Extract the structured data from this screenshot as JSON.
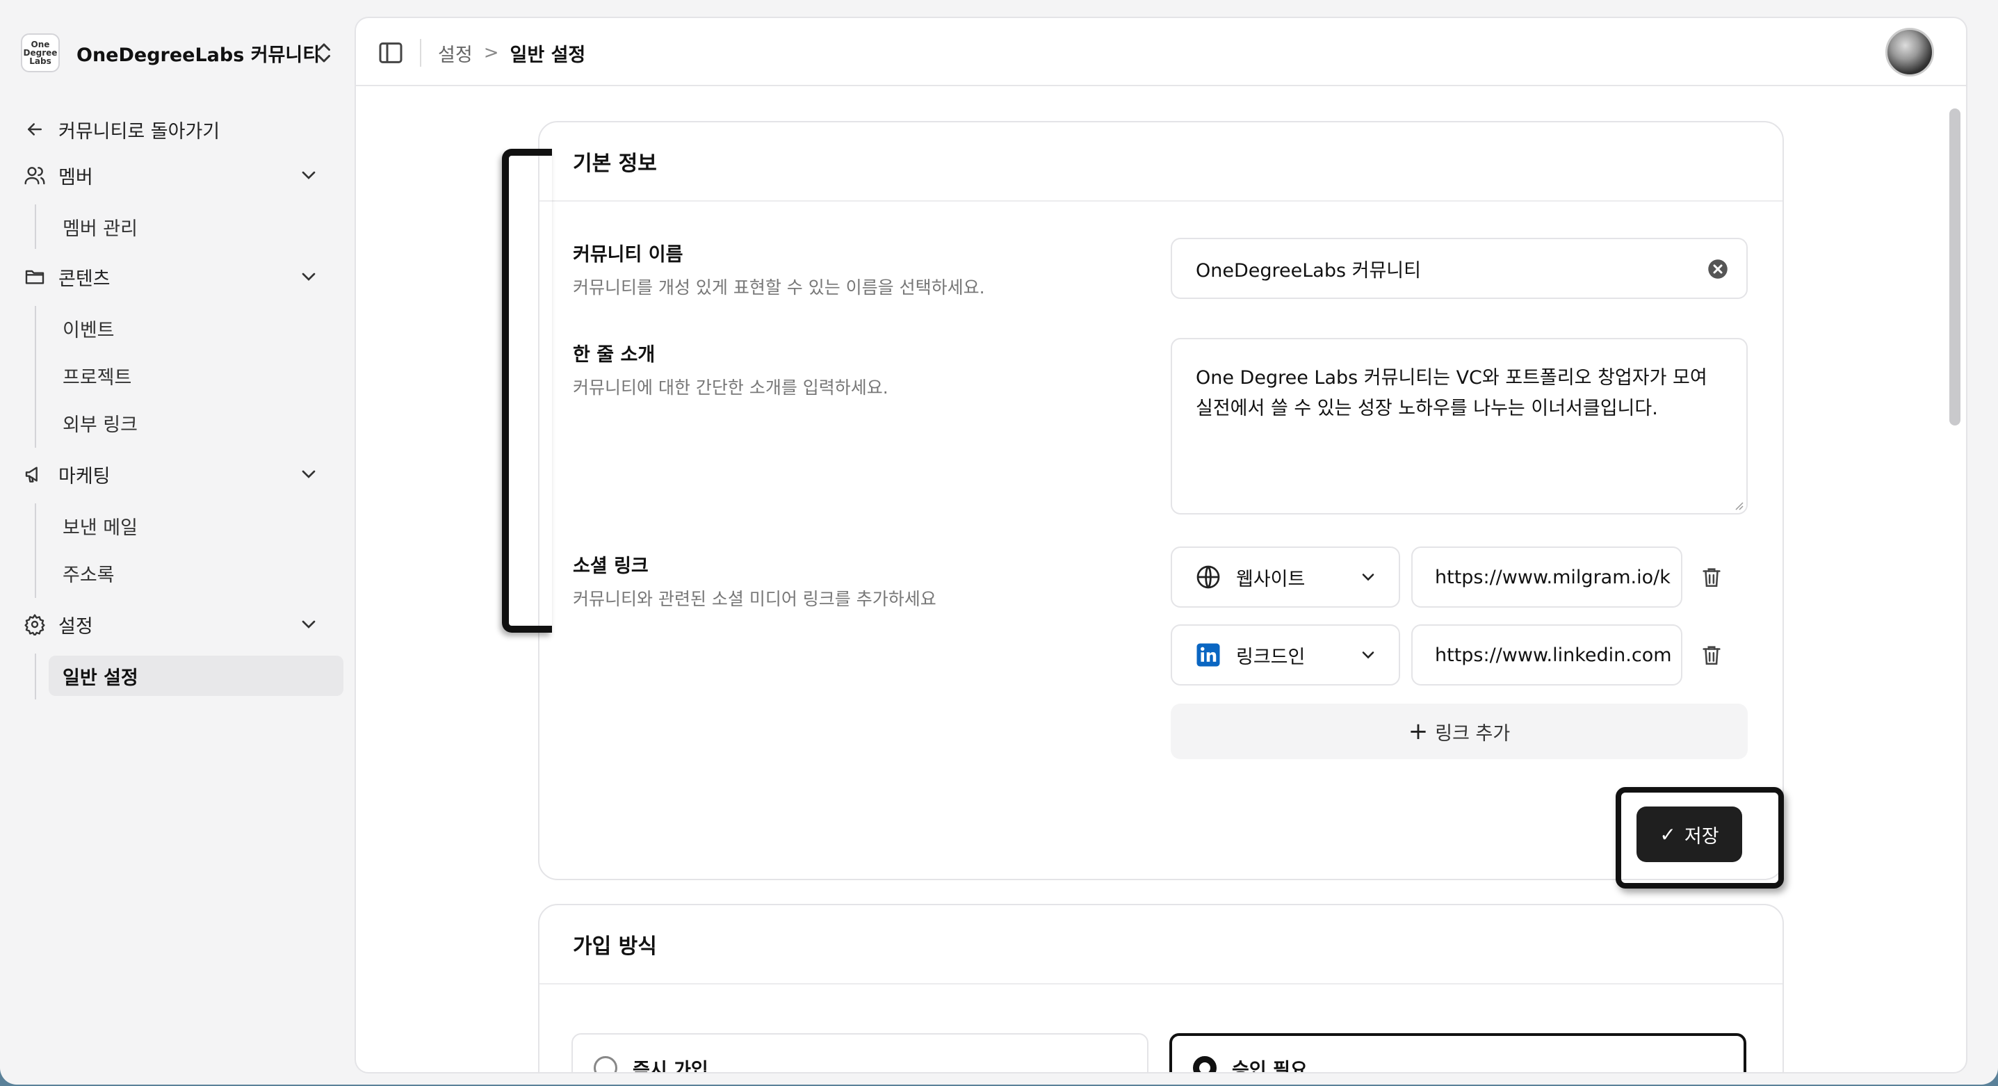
{
  "org": {
    "logo_text": "One\nDegree\nLabs",
    "name": "OneDegreeLabs 커뮤니티"
  },
  "sidebar": {
    "back_label": "커뮤니티로 돌아가기",
    "groups": [
      {
        "label": "멤버",
        "icon": "users-icon",
        "items": [
          "멤버 관리"
        ]
      },
      {
        "label": "콘텐츠",
        "icon": "folder-icon",
        "items": [
          "이벤트",
          "프로젝트",
          "외부 링크"
        ]
      },
      {
        "label": "마케팅",
        "icon": "megaphone-icon",
        "items": [
          "보낸 메일",
          "주소록"
        ]
      },
      {
        "label": "설정",
        "icon": "gear-icon",
        "items": [
          "일반 설정"
        ]
      }
    ],
    "active_item": "일반 설정"
  },
  "breadcrumb": {
    "parent": "설정",
    "separator": ">",
    "current": "일반 설정"
  },
  "basic_info": {
    "title": "기본 정보",
    "name": {
      "label": "커뮤니티 이름",
      "description": "커뮤니티를 개성 있게 표현할 수 있는 이름을 선택하세요.",
      "value": "OneDegreeLabs 커뮤니티"
    },
    "intro": {
      "label": "한 줄 소개",
      "description": "커뮤니티에 대한 간단한 소개를 입력하세요.",
      "value": "One Degree Labs 커뮤니티는 VC와 포트폴리오 창업자가 모여 실전에서 쓸 수 있는 성장 노하우를 나누는 이너서클입니다."
    },
    "social": {
      "label": "소셜 링크",
      "description": "커뮤니티와 관련된 소셜 미디어 링크를 추가하세요",
      "links": [
        {
          "type": "웹사이트",
          "icon": "globe-icon",
          "url": "https://www.milgram.io/k"
        },
        {
          "type": "링크드인",
          "icon": "linkedin-icon",
          "url": "https://www.linkedin.com"
        }
      ],
      "add_label": "링크 추가"
    },
    "save_label": "저장"
  },
  "join_method": {
    "title": "가입 방식",
    "options": [
      {
        "label": "즉시 가입",
        "selected": false
      },
      {
        "label": "승인 필요",
        "selected": true
      }
    ]
  },
  "colors": {
    "accent": "#1f1f1f",
    "background": "#f4f4f5",
    "border": "#e4e4e7"
  }
}
